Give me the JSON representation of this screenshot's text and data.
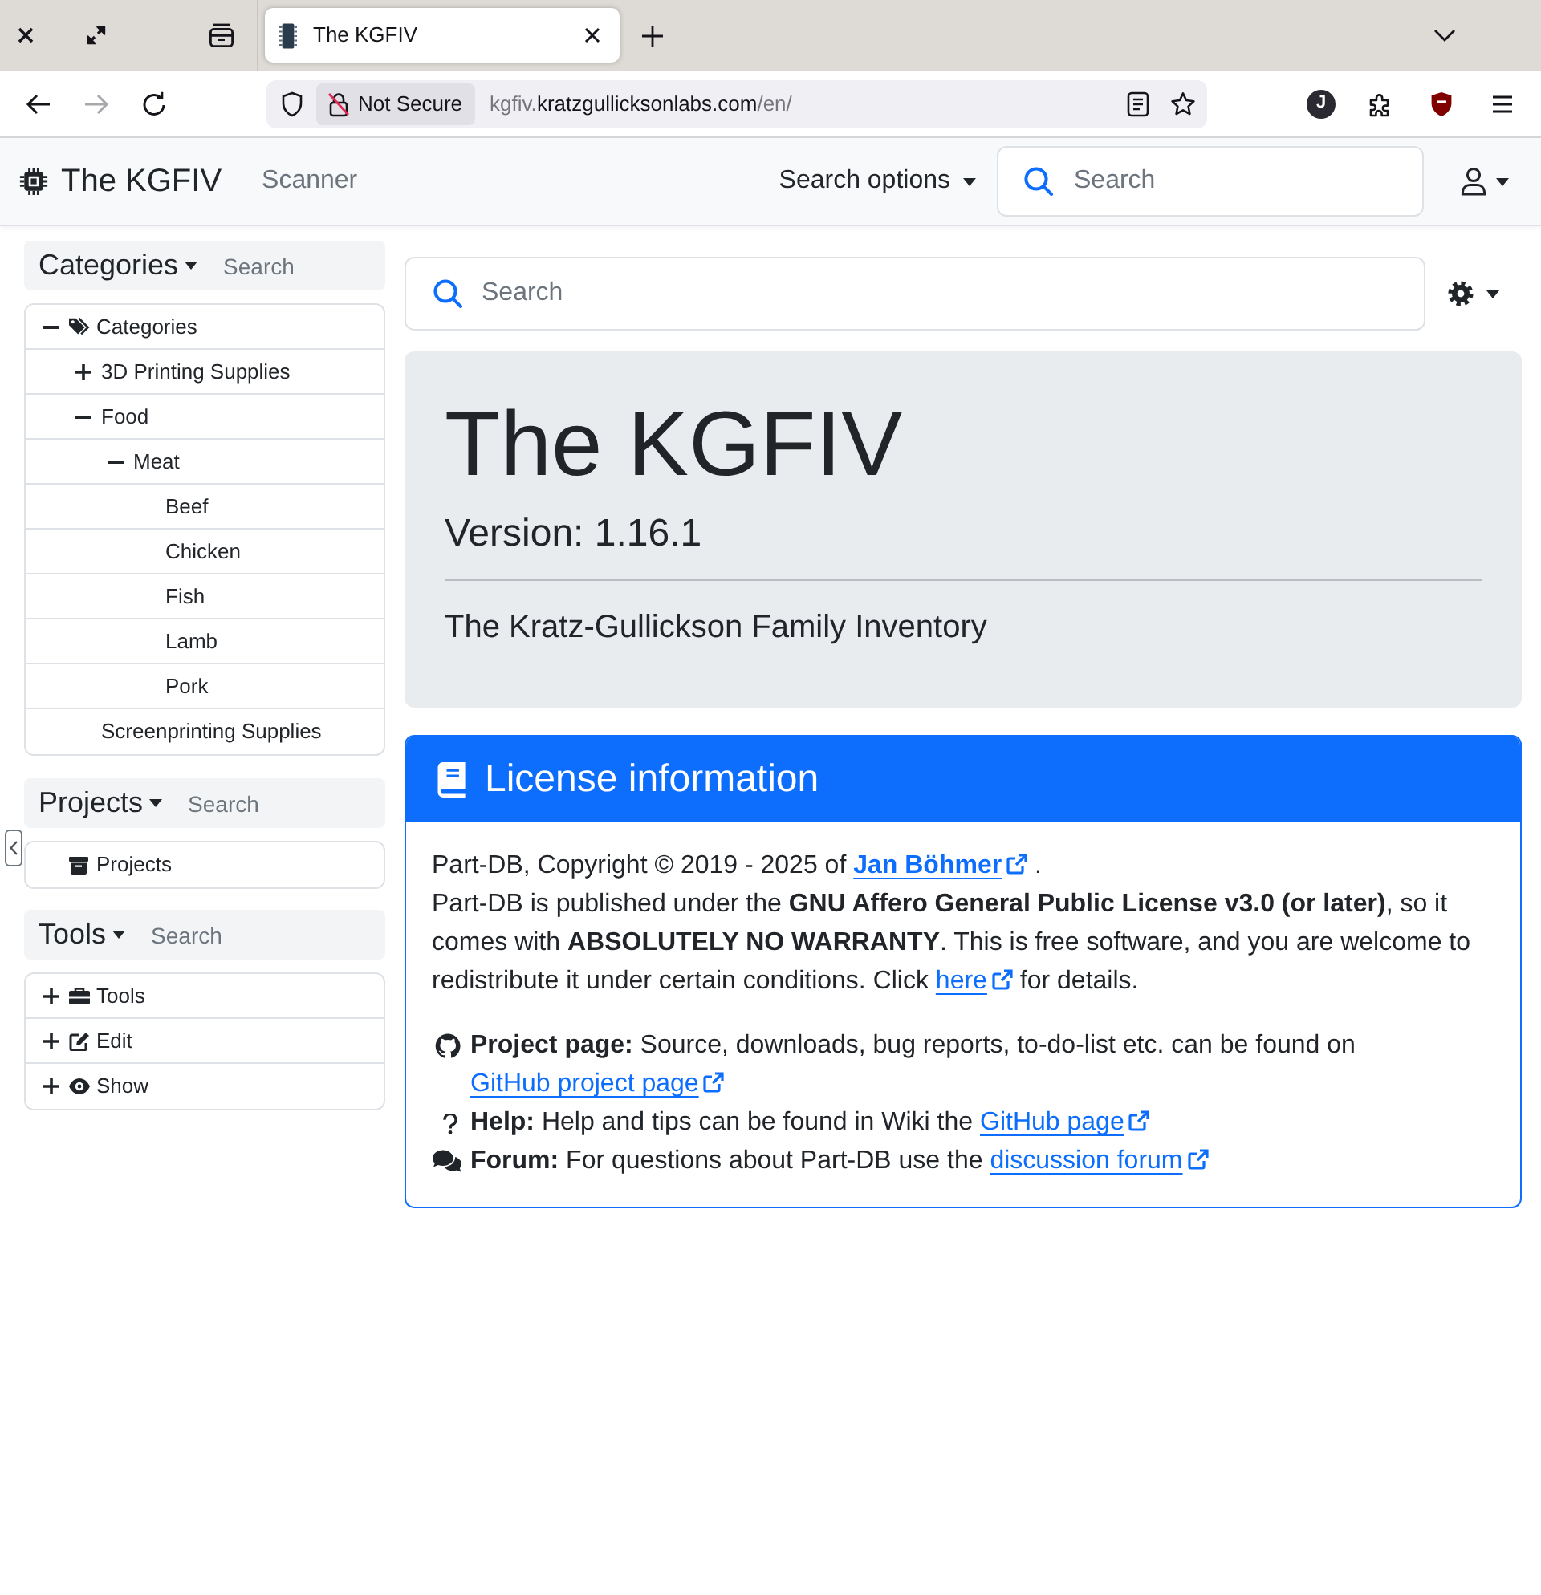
{
  "browser": {
    "tabs": [
      {
        "title": "The KGFIV",
        "selected": true
      }
    ],
    "navigation": {
      "back": {
        "disabled": false
      },
      "forward": {
        "disabled": true
      }
    },
    "security_label": "Not Secure",
    "url": {
      "subdomain": "kgfiv.",
      "domain": "kratzgullicksonlabs.com",
      "path": "/en/"
    },
    "profile_initial": "J"
  },
  "navbar": {
    "brand": "The KGFIV",
    "links": [
      "Scanner"
    ],
    "search_options": "Search options",
    "search": {
      "placeholder": "Search"
    }
  },
  "sidebar": {
    "panels": [
      {
        "title": "Categories",
        "search": {
          "placeholder": "Search"
        },
        "tree": [
          {
            "label": "Categories",
            "kind": "branch",
            "expanded": true,
            "children": [
              {
                "label": "3D Printing Supplies",
                "kind": "branch",
                "expanded": false
              },
              {
                "label": "Food",
                "kind": "branch",
                "expanded": true,
                "children": [
                  {
                    "label": "Meat",
                    "kind": "branch",
                    "expanded": true,
                    "children": [
                      {
                        "label": "Beef",
                        "kind": "leaf"
                      },
                      {
                        "label": "Chicken",
                        "kind": "leaf"
                      },
                      {
                        "label": "Fish",
                        "kind": "leaf"
                      },
                      {
                        "label": "Lamb",
                        "kind": "leaf"
                      },
                      {
                        "label": "Pork",
                        "kind": "leaf"
                      }
                    ]
                  }
                ]
              },
              {
                "label": "Screenprinting Supplies",
                "kind": "leaf"
              }
            ]
          }
        ]
      },
      {
        "title": "Projects",
        "search": {
          "placeholder": "Search"
        },
        "tree": [
          {
            "label": "Projects",
            "kind": "leaf"
          }
        ]
      },
      {
        "title": "Tools",
        "search": {
          "placeholder": "Search"
        },
        "tree": [
          {
            "label": "Tools",
            "kind": "branch",
            "expanded": false
          },
          {
            "label": "Edit",
            "kind": "branch",
            "expanded": false
          },
          {
            "label": "Show",
            "kind": "branch",
            "expanded": false
          }
        ]
      }
    ]
  },
  "main": {
    "search": {
      "placeholder": "Search"
    },
    "hero": {
      "title": "The KGFIV",
      "version": "Version: 1.16.1",
      "subtitle": "The Kratz-Gullickson Family Inventory"
    },
    "license": {
      "title": "License information",
      "paragraphs": [
        [
          {
            "parts": [
              {
                "kind": "text",
                "text": "Part-DB, Copyright © 2019 - 2025 of "
              },
              {
                "kind": "link",
                "text": "Jan Böhmer",
                "bold": true
              },
              {
                "kind": "text",
                "text": " ."
              }
            ]
          },
          {
            "parts": [
              {
                "kind": "text",
                "text": "Part-DB is published under the **GNU Affero General Public License v3.0 (or later)**, so it comes with **ABSOLUTELY NO WARRANTY**. This is free software, and you are welcome to redistribute it under certain conditions. Click "
              },
              {
                "kind": "link",
                "text": "here"
              },
              {
                "kind": "text",
                "text": " for details."
              }
            ]
          }
        ],
        [
          {
            "parts": [
              {
                "kind": "text",
                "text": "**Project page:** Source, downloads, bug reports, to-do-list etc. can be found on "
              },
              {
                "kind": "link",
                "text": "GitHub project page"
              }
            ]
          },
          {
            "parts": [
              {
                "kind": "text",
                "text": "**Help:** Help and tips can be found in Wiki the "
              },
              {
                "kind": "link",
                "text": "GitHub page"
              }
            ]
          },
          {
            "parts": [
              {
                "kind": "text",
                "text": "**Forum:** For questions about Part-DB use the "
              },
              {
                "kind": "link",
                "text": "discussion forum"
              }
            ]
          }
        ]
      ]
    }
  }
}
